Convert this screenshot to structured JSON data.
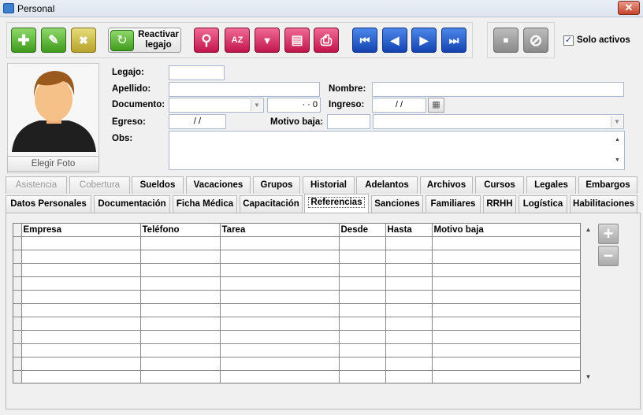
{
  "window": {
    "title": "Personal",
    "close": "✕"
  },
  "toolbar": {
    "add": "✚",
    "edit": "✎",
    "delete": "✖",
    "reactivar_line1": "Reactivar",
    "reactivar_line2": "legajo",
    "search": "⚲",
    "sort": "AZ",
    "filter": "▼",
    "report": "▤",
    "print": "⎙",
    "first": "⏮",
    "prev": "◀",
    "next": "▶",
    "last": "⏭",
    "save": "▪",
    "cancel": "⊘",
    "solo_activos": "Solo activos",
    "solo_activos_checked": "✓"
  },
  "photo": {
    "button": "Elegir Foto"
  },
  "form": {
    "legajo_label": "Legajo:",
    "legajo_value": "",
    "apellido_label": "Apellido:",
    "apellido_value": "",
    "nombre_label": "Nombre:",
    "nombre_value": "",
    "documento_label": "Documento:",
    "documento_type": "",
    "documento_number": "·  ·  0",
    "ingreso_label": "Ingreso:",
    "ingreso_value": "/ /",
    "egreso_label": "Egreso:",
    "egreso_value": "/ /",
    "motivo_baja_label": "Motivo baja:",
    "motivo_baja_code": "",
    "motivo_baja_value": "",
    "obs_label": "Obs:",
    "obs_value": ""
  },
  "tabs_row1": [
    "Asistencia",
    "Cobertura",
    "Sueldos",
    "Vacaciones",
    "Grupos",
    "Historial",
    "Adelantos",
    "Archivos",
    "Cursos",
    "Legales",
    "Embargos"
  ],
  "tabs_row2": [
    "Datos Personales",
    "Documentación",
    "Ficha Médica",
    "Capacitación",
    "Referencias",
    "Sanciones",
    "Familiares",
    "RRHH",
    "Logística",
    "Habilitaciones"
  ],
  "grid": {
    "columns": [
      "Empresa",
      "Teléfono",
      "Tarea",
      "Desde",
      "Hasta",
      "Motivo baja"
    ],
    "rows": []
  },
  "side": {
    "add": "+",
    "remove": "−"
  },
  "colors": {
    "accent_green": "#3f9b1d",
    "accent_pink": "#c2154c",
    "accent_blue": "#1443b2"
  }
}
